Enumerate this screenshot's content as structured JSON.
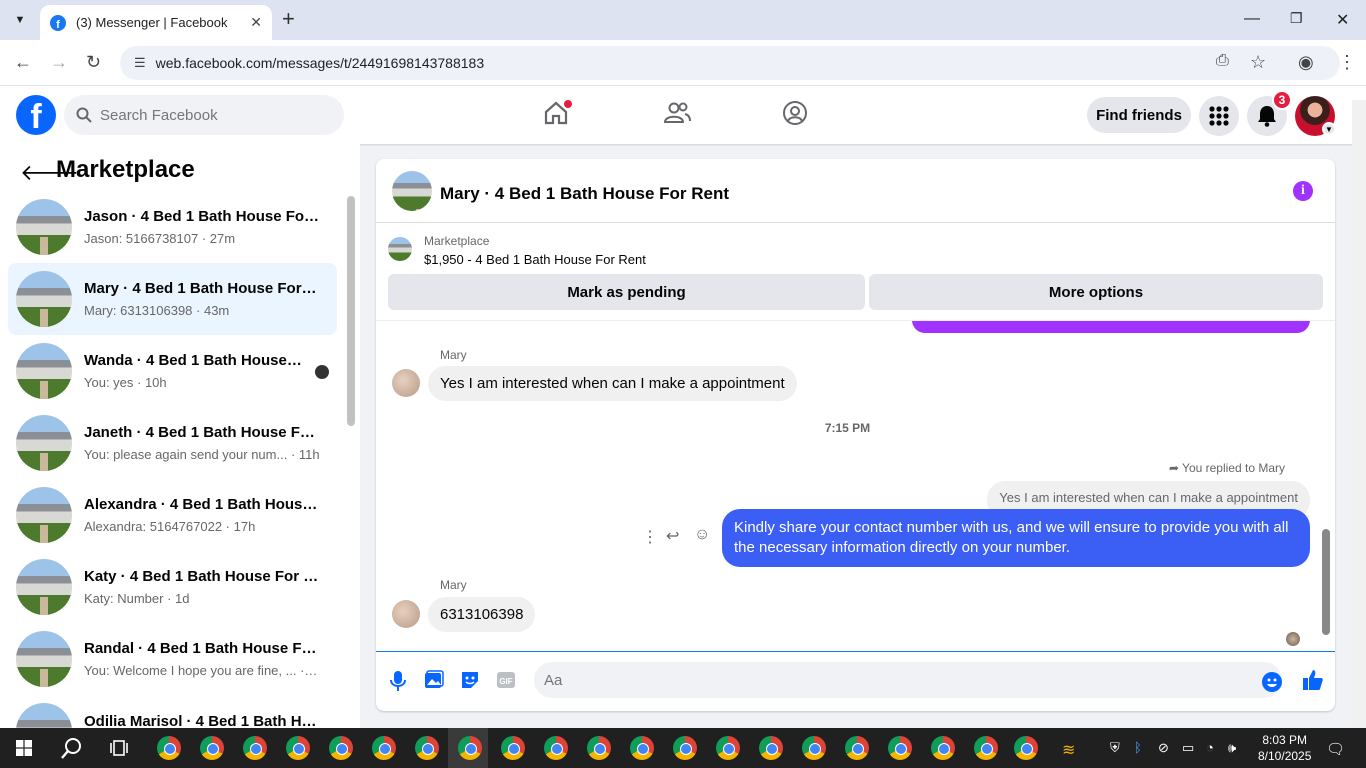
{
  "browser": {
    "tab_title": "(3) Messenger | Facebook",
    "url": "web.facebook.com/messages/t/24491698143788183"
  },
  "header": {
    "search_placeholder": "Search Facebook",
    "find_friends": "Find friends",
    "notification_count": "3"
  },
  "sidebar": {
    "title": "Marketplace",
    "conversations": [
      {
        "name": "Jason · 4 Bed 1 Bath House For R...",
        "preview": "Jason: 5166738107 · 27m",
        "active": false
      },
      {
        "name": "Mary · 4 Bed 1 Bath House For R...",
        "preview": "Mary: 6313106398 · 43m",
        "active": true
      },
      {
        "name": "Wanda · 4 Bed 1 Bath House F...",
        "preview": "You: yes · 10h",
        "active": false
      },
      {
        "name": "Janeth · 4 Bed 1 Bath House For ...",
        "preview": "You: please again send your num... · 11h",
        "active": false
      },
      {
        "name": "Alexandra · 4 Bed 1 Bath House ...",
        "preview": "Alexandra: 5164767022 · 17h",
        "active": false
      },
      {
        "name": "Katy · 4 Bed 1 Bath House For Re...",
        "preview": "Katy: Number · 1d",
        "active": false
      },
      {
        "name": "Randal · 4 Bed 1 Bath House For ...",
        "preview": "You: Welcome I hope you are fine, ... · 2d",
        "active": false
      },
      {
        "name": "Odilia Marisol · 4 Bed 1 Bath Ho...",
        "preview": "",
        "active": false
      }
    ]
  },
  "chat": {
    "title": "Mary · 4 Bed 1 Bath House For Rent",
    "listing_label": "Marketplace",
    "listing_price": "$1,950 - 4 Bed 1 Bath House For Rent",
    "mark_pending": "Mark as pending",
    "more_options": "More options",
    "messages": {
      "sender1": "Mary",
      "msg1": "Yes I am interested when can I make a appointment",
      "timestamp": "7:15 PM",
      "replied_label": "You replied to Mary",
      "quoted": "Yes I am interested when can I make a appointment",
      "outgoing": "Kindly share your contact number with us, and we will ensure to provide you with all the necessary information directly on your number.",
      "sender2": "Mary",
      "msg2": "6313106398"
    },
    "composer_placeholder": "Aa"
  },
  "taskbar": {
    "time": "8:03 PM",
    "date": "8/10/2025"
  },
  "colors": {
    "fb_blue": "#0866ff",
    "outgoing_bubble": "#3b5ef5",
    "accent_purple": "#a033ff",
    "badge_red": "#e41e3f"
  }
}
